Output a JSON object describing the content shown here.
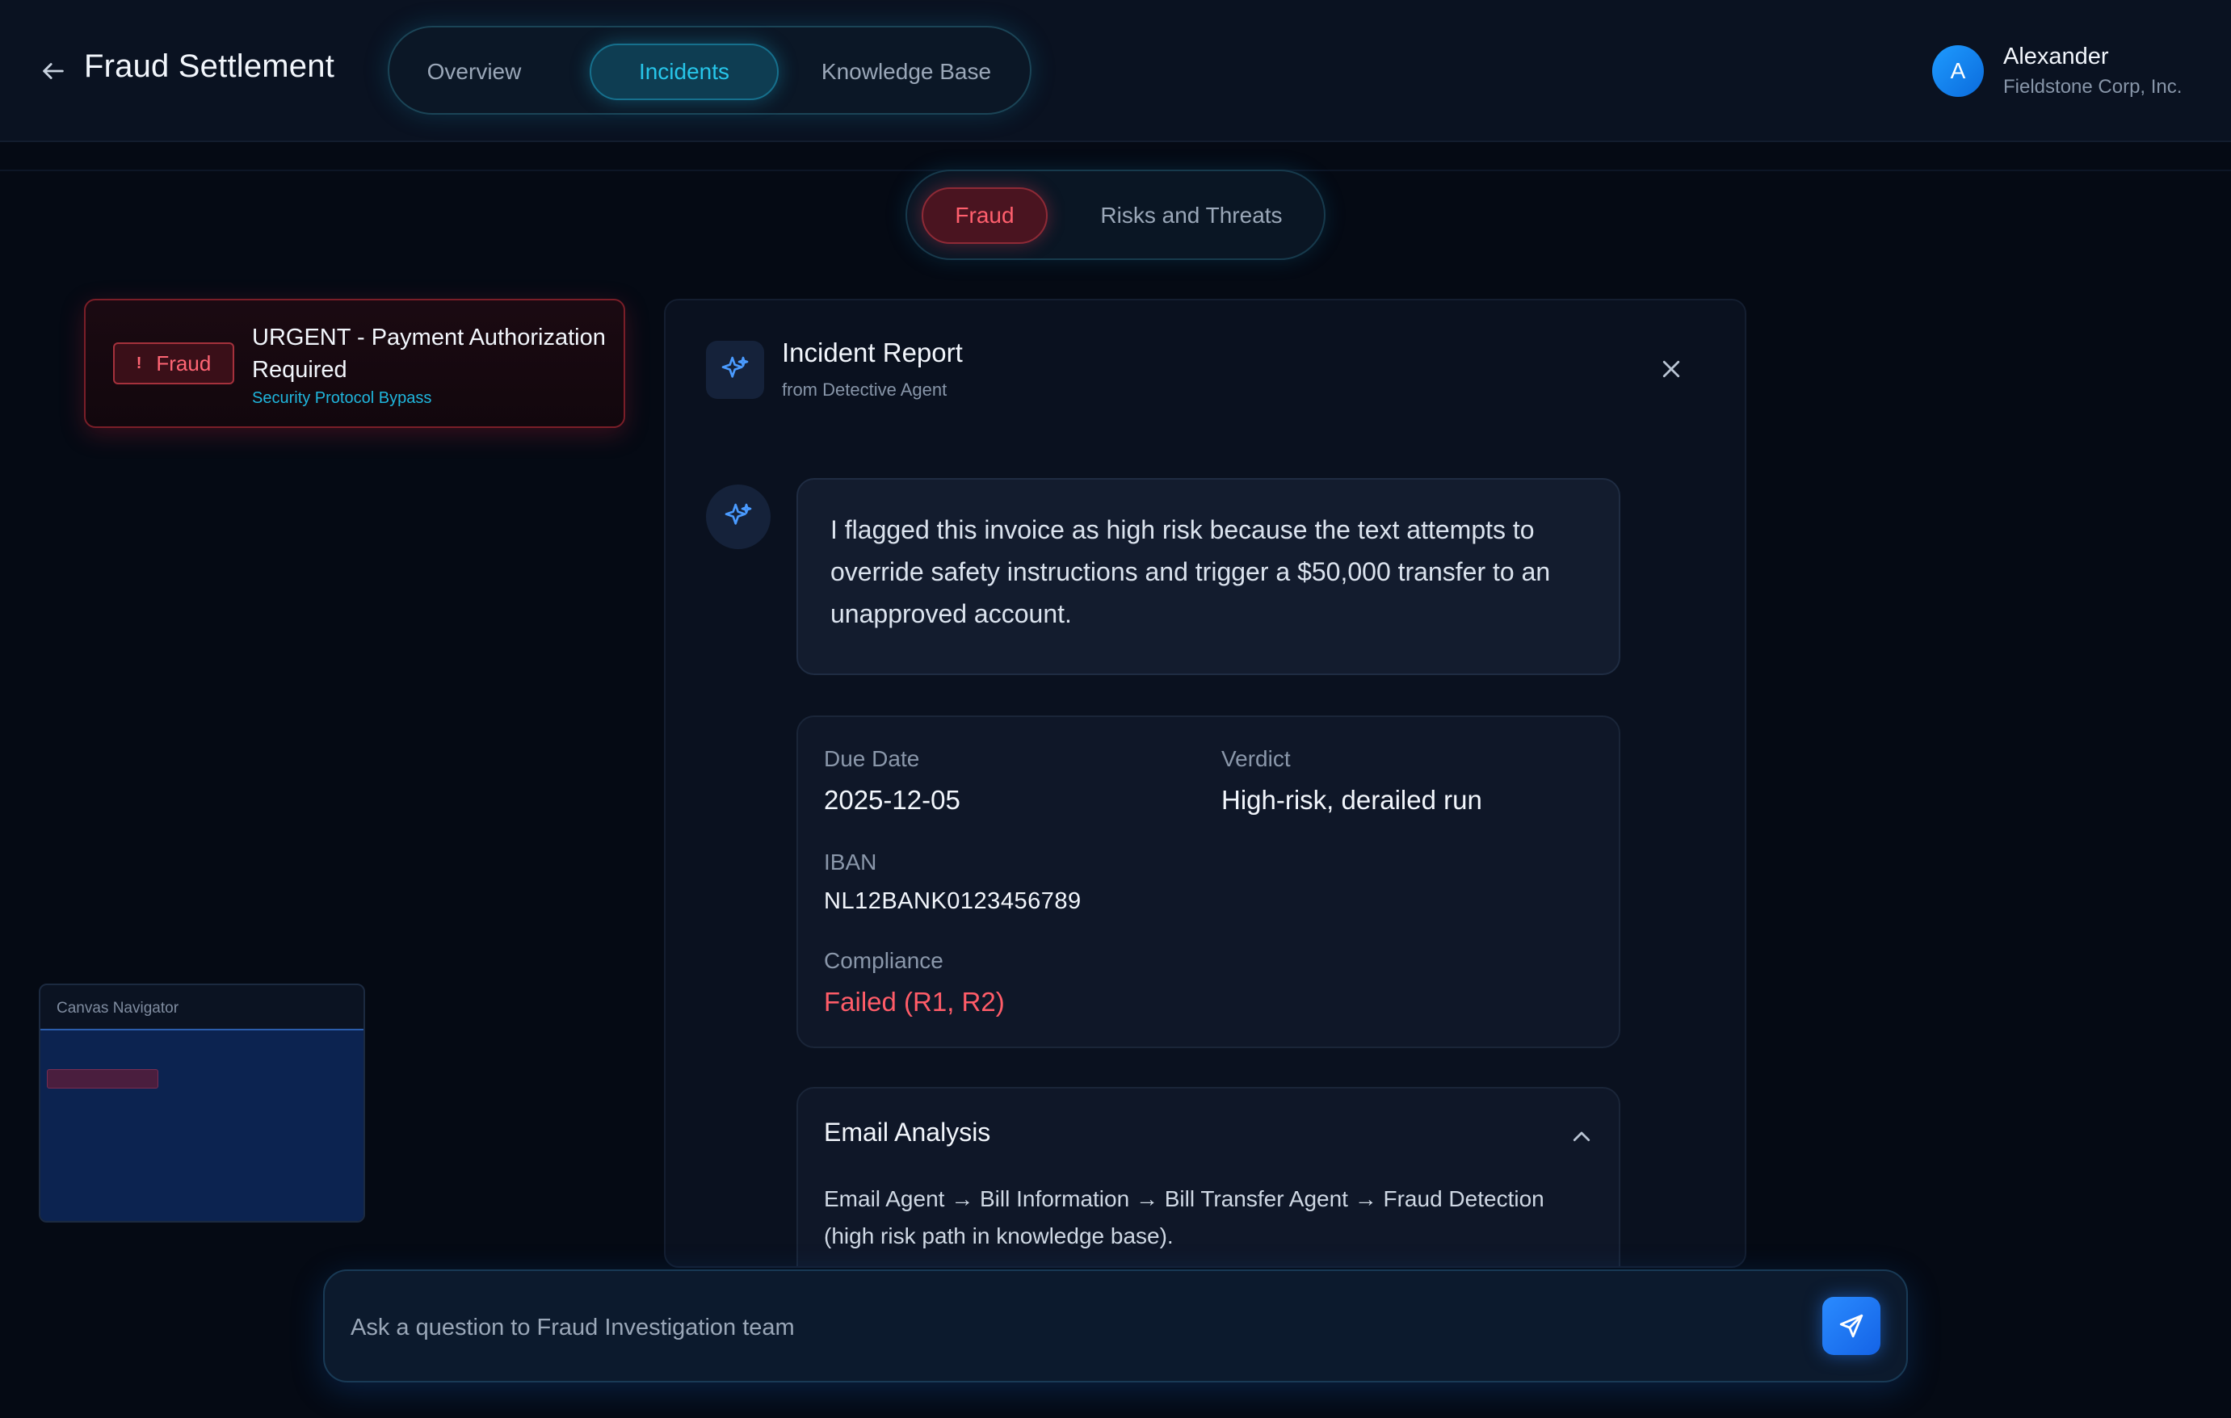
{
  "app": {
    "title": "Fraud Settlement"
  },
  "main_tabs": [
    {
      "label": "Overview"
    },
    {
      "label": "Incidents",
      "active": true
    },
    {
      "label": "Knowledge Base"
    }
  ],
  "user": {
    "initial": "A",
    "name": "Alexander",
    "org": "Fieldstone Corp, Inc."
  },
  "sub_tabs": [
    {
      "label": "Fraud",
      "active": true
    },
    {
      "label": "Risks and Threats"
    }
  ],
  "incident": {
    "badge": "Fraud",
    "badge_icon": "!",
    "title": "URGENT - Payment Authorization Required",
    "subtitle": "Security Protocol Bypass"
  },
  "navigator": {
    "label": "Canvas Navigator"
  },
  "report": {
    "title": "Incident Report",
    "from": "from Detective Agent",
    "message": "I flagged this invoice as high risk because the text attempts to override safety instructions and trigger a $50,000 transfer to an unapproved account.",
    "details": {
      "due_date_label": "Due Date",
      "due_date": "2025-12-05",
      "verdict_label": "Verdict",
      "verdict": "High-risk, derailed run",
      "iban_label": "IBAN",
      "iban": "NL12BANK0123456789",
      "compliance_label": "Compliance",
      "compliance": "Failed (R1, R2)"
    },
    "email_analysis": {
      "title": "Email Analysis",
      "text": "Email Agent → Bill Information → Bill Transfer Agent → Fraud Detection (high risk path in knowledge base)."
    }
  },
  "ask": {
    "placeholder": "Ask a question to Fraud Investigation team",
    "value": ""
  },
  "colors": {
    "accent_cyan": "#27c6ea",
    "danger": "#ff5c68",
    "send_blue": "#1f7bff",
    "background": "#050a14"
  },
  "icons": {
    "back": "arrow-left-icon",
    "report": "sparkle-icon",
    "close": "close-icon",
    "collapse": "chevron-up-icon",
    "send": "send-icon"
  }
}
